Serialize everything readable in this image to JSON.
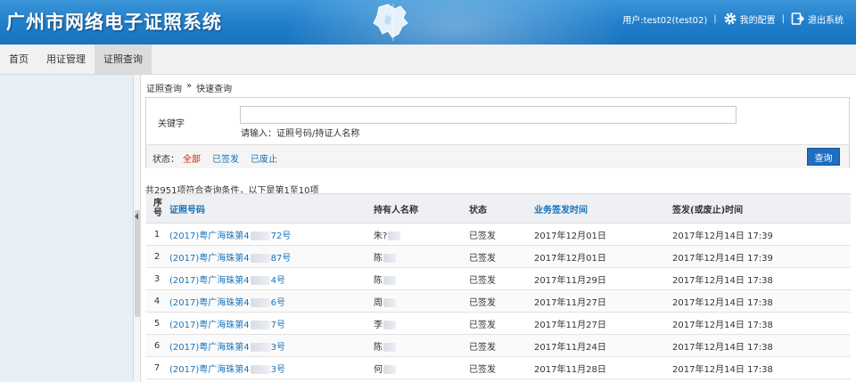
{
  "header": {
    "title": "广州市网络电子证照系统",
    "user_label": "用户:test02(test02)",
    "settings_label": "我的配置",
    "logout_label": "退出系统"
  },
  "nav": {
    "tabs": [
      {
        "label": "首页",
        "active": false
      },
      {
        "label": "用证管理",
        "active": false
      },
      {
        "label": "证照查询",
        "active": true
      }
    ]
  },
  "breadcrumb": {
    "root": "证照查询",
    "sep": "»",
    "current": "快速查询"
  },
  "search": {
    "keyword_label": "关键字",
    "keyword_value": "",
    "hint": "请输入：证照号码/持证人名称",
    "status_label": "状态：",
    "status_all": "全部",
    "status_issued": "已签发",
    "status_void": "已废止",
    "query_button": "查询"
  },
  "summary": "共2951项符合查询条件，以下是第1至10项",
  "table": {
    "columns": {
      "index": "序号",
      "cert_no": "证照号码",
      "holder": "持有人名称",
      "status": "状态",
      "business_time": "业务签发时间",
      "issue_time": "签发(或废止)时间"
    },
    "rows": [
      {
        "index": "1",
        "cert_pre": "(2017)粤广海珠第4",
        "cert_post": "72号",
        "holder": "朱?",
        "status": "已签发",
        "business_time": "2017年12月01日",
        "issue_time": "2017年12月14日 17:39"
      },
      {
        "index": "2",
        "cert_pre": "(2017)粤广海珠第4",
        "cert_post": "87号",
        "holder": "陈",
        "status": "已签发",
        "business_time": "2017年12月01日",
        "issue_time": "2017年12月14日 17:39"
      },
      {
        "index": "3",
        "cert_pre": "(2017)粤广海珠第4",
        "cert_post": "4号",
        "holder": "陈",
        "status": "已签发",
        "business_time": "2017年11月29日",
        "issue_time": "2017年12月14日 17:38"
      },
      {
        "index": "4",
        "cert_pre": "(2017)粤广海珠第4",
        "cert_post": "6号",
        "holder": "周",
        "status": "已签发",
        "business_time": "2017年11月27日",
        "issue_time": "2017年12月14日 17:38"
      },
      {
        "index": "5",
        "cert_pre": "(2017)粤广海珠第4",
        "cert_post": "7号",
        "holder": "李",
        "status": "已签发",
        "business_time": "2017年11月27日",
        "issue_time": "2017年12月14日 17:38"
      },
      {
        "index": "6",
        "cert_pre": "(2017)粤广海珠第4",
        "cert_post": "3号",
        "holder": "陈",
        "status": "已签发",
        "business_time": "2017年11月24日",
        "issue_time": "2017年12月14日 17:38"
      },
      {
        "index": "7",
        "cert_pre": "(2017)粤广海珠第4",
        "cert_post": "3号",
        "holder": "何",
        "status": "已签发",
        "business_time": "2017年11月28日",
        "issue_time": "2017年12月14日 17:38"
      }
    ]
  }
}
